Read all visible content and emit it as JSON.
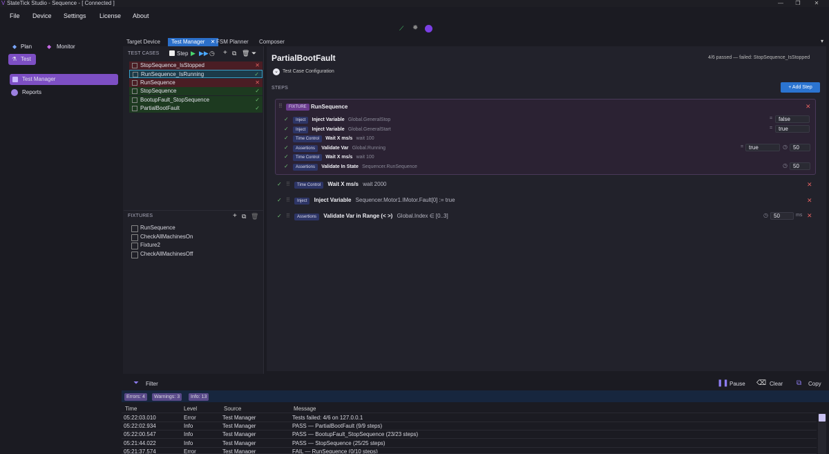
{
  "window": {
    "title": "StateTick Studio  -  Sequence  -  [ Connected ]",
    "min": "—",
    "max": "❐",
    "close": "✕"
  },
  "menu": [
    "File",
    "Device",
    "Settings",
    "License",
    "About"
  ],
  "left": {
    "plan": "Plan",
    "monitor": "Monitor",
    "test": "Test",
    "items": [
      {
        "label": "Test Manager"
      },
      {
        "label": "Reports"
      }
    ]
  },
  "tabs": [
    {
      "label": "Target Device"
    },
    {
      "label": "Test Manager",
      "close": "✕"
    },
    {
      "label": "FSM Planner"
    },
    {
      "label": "Composer"
    }
  ],
  "test_cases": {
    "header": "TEST CASES",
    "step_label": "Step",
    "items": [
      {
        "label": "StopSequence_IsStopped",
        "status": "fail",
        "mark": "✕"
      },
      {
        "label": "RunSequence_IsRunning",
        "status": "pass-selected",
        "mark": "✓"
      },
      {
        "label": "RunSequence",
        "status": "fail",
        "mark": "✕"
      },
      {
        "label": "StopSequence",
        "status": "pass",
        "mark": "✓"
      },
      {
        "label": "BootupFault_StopSequence",
        "status": "pass",
        "mark": "✓"
      },
      {
        "label": "PartialBootFault",
        "status": "pass",
        "mark": "✓"
      }
    ]
  },
  "fixtures": {
    "header": "FIXTURES",
    "items": [
      "RunSequence",
      "CheckAllMachinesOn",
      "Fixture2",
      "CheckAllMachinesOff"
    ]
  },
  "detail": {
    "title": "PartialBootFault",
    "summary": "4/6 passed — failed: StopSequence_IsStopped",
    "config": "Test Case Configuration",
    "steps_label": "STEPS",
    "add_step": "+ Add Step",
    "fixture": {
      "tag": "FIXTURE",
      "name": "RunSequence",
      "steps": [
        {
          "tag": "Inject",
          "name": "Inject Variable",
          "arg": "Global.GeneralStop",
          "eq": "=",
          "value": "false"
        },
        {
          "tag": "Inject",
          "name": "Inject Variable",
          "arg": "Global.GeneralStart",
          "eq": "=",
          "value": "true"
        },
        {
          "tag": "Time Control",
          "name": "Wait X ms/s",
          "arg": "wait 100"
        },
        {
          "tag": "Assertions",
          "name": "Validate Var",
          "arg": "Global.Running",
          "eq": "=",
          "value": "true",
          "timeout": "50"
        },
        {
          "tag": "Time Control",
          "name": "Wait X ms/s",
          "arg": "wait 100"
        },
        {
          "tag": "Assertions",
          "name": "Validate In State",
          "arg": "Sequencer.RunSequence",
          "timeout": "50"
        }
      ]
    },
    "steps": [
      {
        "tag": "Time Control",
        "name": "Wait X ms/s",
        "arg": "wait 2000"
      },
      {
        "tag": "Inject",
        "name": "Inject Variable",
        "arg": "Sequencer.Motor1.IMotor.Fault[0] := true"
      },
      {
        "tag": "Assertions",
        "name": "Validate Var in Range (< >)",
        "arg": "Global.Index ∈ [0..3]",
        "timeout": "50",
        "unit": "ms"
      }
    ]
  },
  "log": {
    "filter": "Filter",
    "pause": "Pause",
    "clear": "Clear",
    "copy": "Copy",
    "badges": [
      "Errors: 4",
      "Warnings: 3",
      "Info: 13"
    ],
    "columns": [
      "Time",
      "Level",
      "Source",
      "Message"
    ],
    "rows": [
      [
        "05:22:03.010",
        "Error",
        "Test Manager",
        "Tests failed: 4/6 on 127.0.0.1"
      ],
      [
        "05:22:02.934",
        "Info",
        "Test Manager",
        "PASS — PartialBootFault (9/9 steps)"
      ],
      [
        "05:22:00.547",
        "Info",
        "Test Manager",
        "PASS — BootupFault_StopSequence (23/23 steps)"
      ],
      [
        "05:21:44.022",
        "Info",
        "Test Manager",
        "PASS — StopSequence (25/25 steps)"
      ],
      [
        "05:21:37.574",
        "Error",
        "Test Manager",
        "FAIL — RunSequence (0/10 steps)"
      ]
    ]
  }
}
